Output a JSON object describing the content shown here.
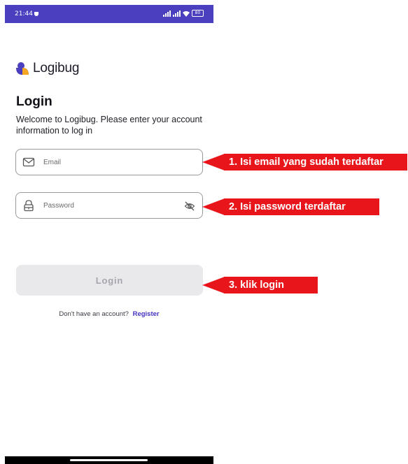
{
  "status_bar": {
    "time": "21:44",
    "battery": "80",
    "background_color": "#4a3fbf"
  },
  "brand": {
    "name": "Logibug",
    "logo_colors": [
      "#4a3fbf",
      "#f5a623"
    ]
  },
  "login_form": {
    "title": "Login",
    "welcome_text": "Welcome to Logibug. Please enter your account information to log in",
    "email": {
      "placeholder": "Email",
      "value": "",
      "icon": "envelope-icon"
    },
    "password": {
      "placeholder": "Password",
      "value": "",
      "icon": "lock-icon",
      "toggle_icon": "eye-off-icon"
    },
    "login_button_label": "Login",
    "register_prompt": "Don't have an account?",
    "register_link_label": "Register"
  },
  "annotations": [
    {
      "label": "1. Isi email yang sudah terdaftar"
    },
    {
      "label": "2. Isi password terdaftar"
    },
    {
      "label": "3. klik login"
    }
  ],
  "colors": {
    "annotation_red": "#e8161b",
    "accent": "#4433c0",
    "disabled_button": "#e9e9ec"
  }
}
